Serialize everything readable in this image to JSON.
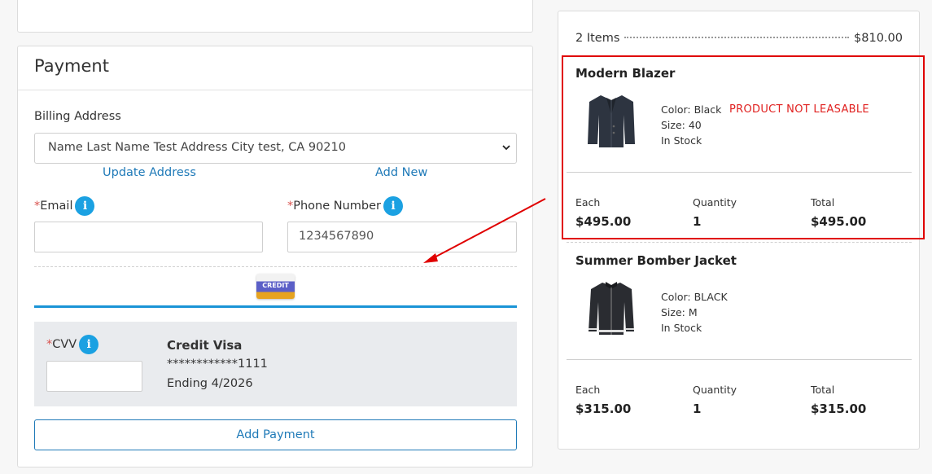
{
  "payment": {
    "title": "Payment",
    "billing_label": "Billing Address",
    "billing_value": "Name Last Name Test Address City test, CA 90210",
    "update_address": "Update Address",
    "add_new": "Add New",
    "required_mark": "*",
    "email_label": "Email",
    "email_value": "",
    "phone_label": "Phone Number",
    "phone_value": "1234567890",
    "info_glyph": "i",
    "credit_badge": "CREDIT",
    "cvv_label": "CVV",
    "card_name": "Credit Visa",
    "card_number": "************1111",
    "card_expiry": "Ending 4/2026",
    "add_payment": "Add Payment"
  },
  "summary": {
    "items_count": "2 Items",
    "items_total": "$810.00",
    "each_label": "Each",
    "quantity_label": "Quantity",
    "total_label": "Total",
    "products": [
      {
        "name": "Modern Blazer",
        "color": "Color: Black",
        "size": "Size: 40",
        "stock": "In Stock",
        "notice": "PRODUCT NOT LEASABLE",
        "each": "$495.00",
        "quantity": "1",
        "total": "$495.00"
      },
      {
        "name": "Summer Bomber Jacket",
        "color": "Color: BLACK",
        "size": "Size: M",
        "stock": "In Stock",
        "each": "$315.00",
        "quantity": "1",
        "total": "$315.00"
      }
    ]
  },
  "colors": {
    "accent": "#1a94d6",
    "link": "#1f7ab8",
    "highlight": "#e00000",
    "notice": "#e0201f"
  }
}
